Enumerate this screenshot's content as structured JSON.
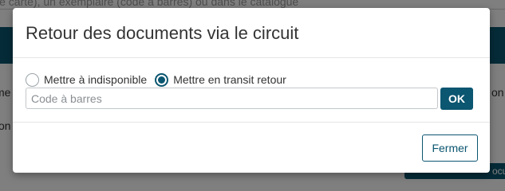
{
  "background": {
    "search_hint": "le carte), un exemplaire (code à barres) ou dans le catalogue",
    "side_text_left_1": "me",
    "side_text_left_2": "on",
    "side_text_right_1": "on",
    "right_button_label": "ocur",
    "colors": {
      "band": "#0b5670",
      "overlay": "rgba(0,0,0,0.5)"
    }
  },
  "modal": {
    "title": "Retour des documents via le circuit",
    "radio_options": [
      {
        "label": "Mettre à indisponible",
        "checked": false
      },
      {
        "label": "Mettre en transit retour",
        "checked": true
      }
    ],
    "barcode_input": {
      "placeholder": "Code à barres",
      "value": ""
    },
    "ok_label": "OK",
    "close_label": "Fermer",
    "colors": {
      "primary": "#0b5670",
      "border": "#c3c7ca"
    }
  }
}
